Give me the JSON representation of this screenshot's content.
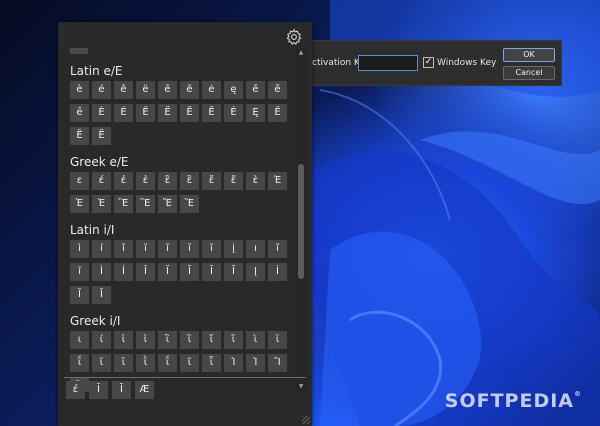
{
  "settings": {
    "activation_label": "Activation Key:",
    "activation_value": "",
    "windows_key_label": "Windows Key",
    "windows_key_checked": true,
    "ok_label": "OK",
    "cancel_label": "Cancel"
  },
  "panel": {
    "partial_top_char": "ˆ",
    "sections": [
      {
        "title": "Latin e/E",
        "chars": [
          "è",
          "é",
          "ê",
          "ë",
          "ē",
          "ĕ",
          "ė",
          "ę",
          "ě",
          "ȅ",
          "ȇ",
          "È",
          "É",
          "Ê",
          "Ë",
          "Ē",
          "Ĕ",
          "Ė",
          "Ę",
          "Ě",
          "Ȅ",
          "Ȇ"
        ]
      },
      {
        "title": "Greek e/E",
        "chars": [
          "ε",
          "έ",
          "ἐ",
          "ἑ",
          "ἒ",
          "ἓ",
          "ἔ",
          "ἕ",
          "ὲ",
          "Έ",
          "Ἐ",
          "Ἑ",
          "Ἒ",
          "Ἓ",
          "Ἔ",
          "Ἕ"
        ]
      },
      {
        "title": "Latin i/I",
        "chars": [
          "ì",
          "í",
          "î",
          "ï",
          "ĩ",
          "ī",
          "ĭ",
          "į",
          "ı",
          "ȉ",
          "ȋ",
          "Ì",
          "Í",
          "Î",
          "Ï",
          "Ĩ",
          "Ī",
          "Ĭ",
          "Į",
          "İ",
          "Ȉ",
          "Ȋ"
        ]
      },
      {
        "title": "Greek i/I",
        "chars": [
          "ι",
          "ί",
          "ἰ",
          "ἱ",
          "ἲ",
          "ἳ",
          "ἴ",
          "ἵ",
          "ὶ",
          "ϊ",
          "ΐ",
          "ῐ",
          "ῑ",
          "ῒ",
          "ΐ",
          "ῖ",
          "ῗ",
          "Ἰ",
          "Ἱ",
          "Ἲ",
          "Ἳ"
        ]
      }
    ],
    "recent": [
      "έ",
      "Ī",
      "Ĭ",
      "Æ"
    ]
  },
  "watermark": "SOFTPEDIA"
}
